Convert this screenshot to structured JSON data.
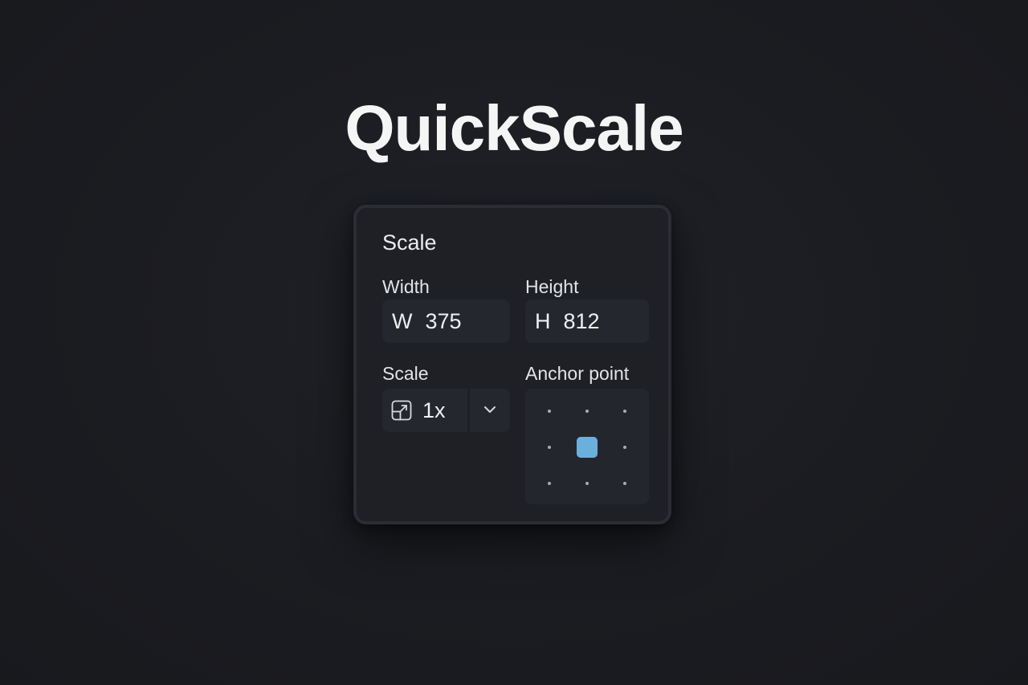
{
  "app": {
    "title": "QuickScale"
  },
  "panel": {
    "title": "Scale",
    "width": {
      "label": "Width",
      "prefix": "W",
      "value": "375"
    },
    "height": {
      "label": "Height",
      "prefix": "H",
      "value": "812"
    },
    "scale": {
      "label": "Scale",
      "icon": "resize-icon",
      "value": "1x",
      "dropdown_icon": "chevron-down-icon"
    },
    "anchor": {
      "label": "Anchor point",
      "selected": "center",
      "points": [
        "top-left",
        "top-center",
        "top-right",
        "middle-left",
        "center",
        "middle-right",
        "bottom-left",
        "bottom-center",
        "bottom-right"
      ]
    }
  },
  "colors": {
    "background": "#1c1d22",
    "panel": "#1e2026",
    "field": "#25272e",
    "accent": "#6bb0dd"
  }
}
